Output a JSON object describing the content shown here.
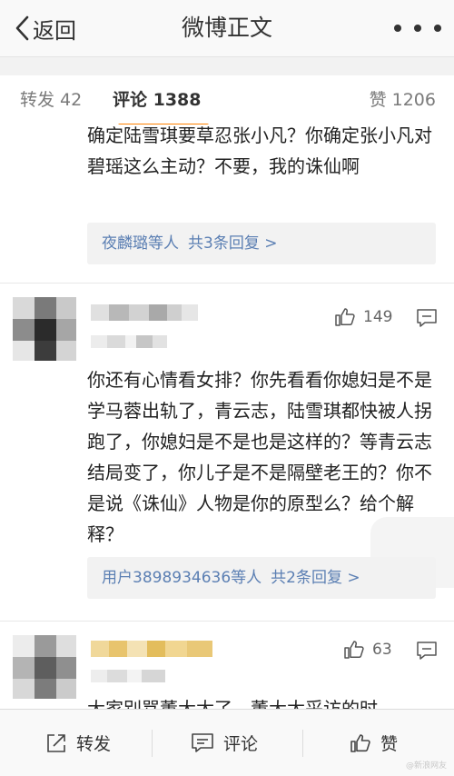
{
  "nav": {
    "back_label": "返回",
    "title": "微博正文"
  },
  "tabs": {
    "repost": "转发 42",
    "comments": "评论 1388",
    "likes": "赞 1206"
  },
  "comments": [
    {
      "text": "确定陆雪琪要草忍张小凡？你确定张小凡对碧瑶这么主动？不要，我的诛仙啊",
      "reply_users": "夜麟璐等人",
      "reply_count": "共3条回复 >"
    },
    {
      "likes": "149",
      "text": "你还有心情看女排？你先看看你媳妇是不是学马蓉出轨了，青云志，陆雪琪都快被人拐跑了，你媳妇是不是也是这样的？等青云志结局变了，你儿子是不是隔壁老王的？你不是说《诛仙》人物是你的原型么？给个解释？",
      "reply_users": "用户3898934636等人",
      "reply_count": "共2条回复 >"
    },
    {
      "likes": "63",
      "text": "大家别骂董大太了，董大太采访的时"
    }
  ],
  "toolbar": {
    "repost": "转发",
    "comment": "评论",
    "like": "赞"
  },
  "watermark": "@新浪网友",
  "colors": {
    "accent": "#ff8200",
    "link": "#5b7fb3",
    "bar_bg": "#f9f9f9"
  },
  "icons": [
    "back-chevron-icon",
    "more-icon",
    "thumb-up-icon",
    "comment-icon",
    "share-icon"
  ]
}
